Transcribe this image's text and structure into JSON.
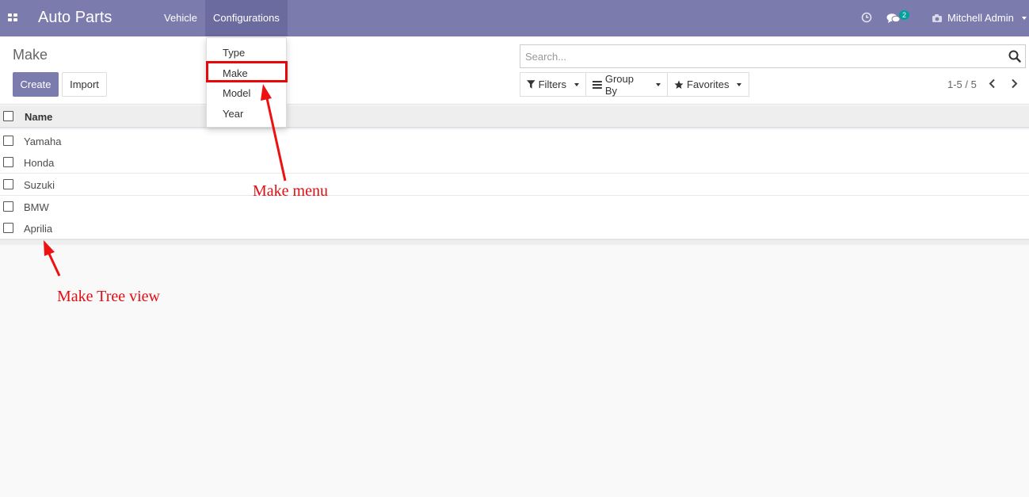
{
  "navbar": {
    "brand": "Auto Parts",
    "menu": [
      {
        "label": "Vehicle",
        "active": false
      },
      {
        "label": "Configurations",
        "active": true
      }
    ],
    "notification_count": "2",
    "user": "Mitchell Admin",
    "color": "#7c7bad"
  },
  "control_panel": {
    "breadcrumb": "Make",
    "create_label": "Create",
    "import_label": "Import",
    "search_placeholder": "Search...",
    "filters_label": "Filters",
    "group_by_label": "Group By",
    "favorites_label": "Favorites",
    "pager": "1-5 / 5"
  },
  "table": {
    "header": "Name",
    "rows": [
      "Yamaha",
      "Honda",
      "Suzuki",
      "BMW",
      "Aprilia"
    ]
  },
  "dropdown": {
    "items": [
      "Type",
      "Make",
      "Model",
      "Year"
    ],
    "highlighted": "Make"
  },
  "annotations": {
    "menu_label": "Make menu",
    "tree_label": "Make Tree view",
    "color": "#e30d12"
  }
}
